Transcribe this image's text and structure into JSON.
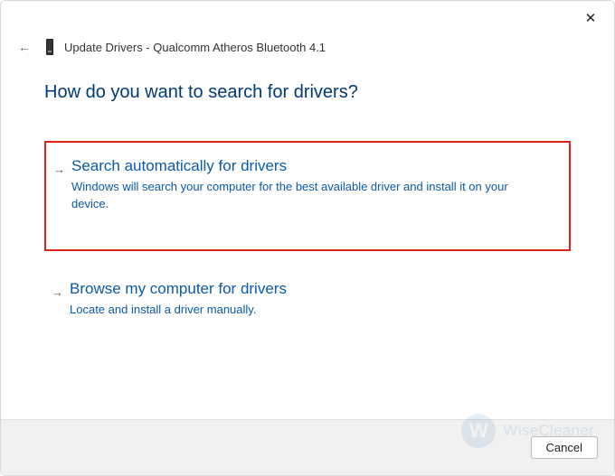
{
  "window": {
    "title": "Update Drivers - Qualcomm Atheros Bluetooth 4.1"
  },
  "heading": "How do you want to search for drivers?",
  "options": [
    {
      "title": "Search automatically for drivers",
      "description": "Windows will search your computer for the best available driver and install it on your device."
    },
    {
      "title": "Browse my computer for drivers",
      "description": "Locate and install a driver manually."
    }
  ],
  "footer": {
    "cancel_label": "Cancel"
  },
  "watermark": {
    "initial": "W",
    "text": "WiseCleaner"
  }
}
